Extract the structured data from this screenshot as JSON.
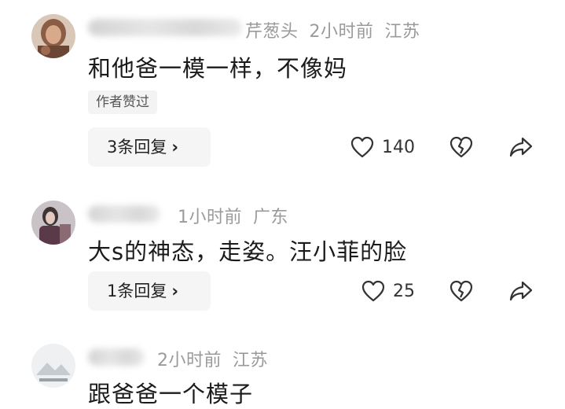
{
  "comments": [
    {
      "name_visible": "芹葱头",
      "time": "2小时前",
      "location": "江苏",
      "text": "和他爸一模一样，不像妈",
      "badge": "作者赞过",
      "reply_label": "3条回复",
      "likes": "140"
    },
    {
      "time": "1小时前",
      "location": "广东",
      "text": "大s的神态，走姿。汪小菲的脸",
      "reply_label": "1条回复",
      "likes": "25"
    },
    {
      "time": "2小时前",
      "location": "江苏",
      "text": "跟爸爸一个模子"
    }
  ],
  "icons": {
    "like": "heart-outline-icon",
    "dislike": "broken-heart-icon",
    "share": "share-arrow-icon",
    "chevron": "chevron-right-icon"
  },
  "colors": {
    "meta_text": "#9a9a9a",
    "main_text": "#1b1b1b",
    "button_bg": "#f5f5f5"
  }
}
